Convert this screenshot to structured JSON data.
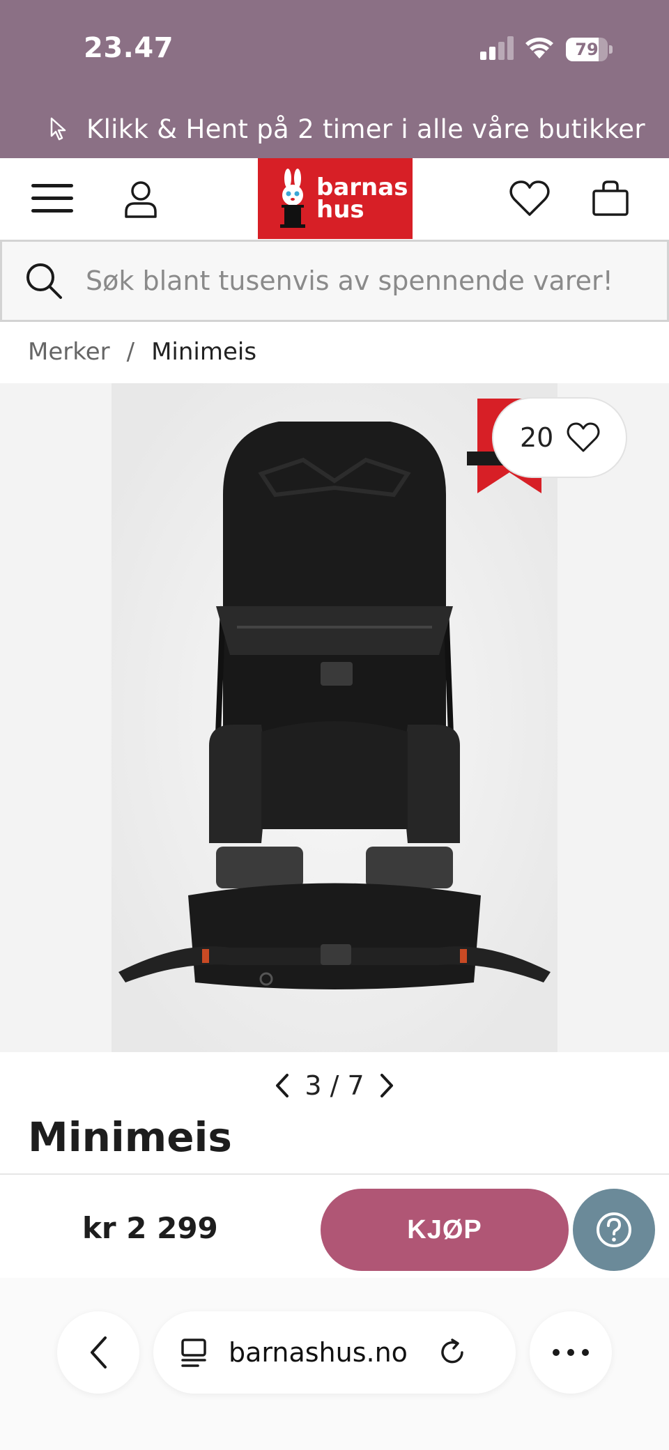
{
  "status_bar": {
    "time": "23.47",
    "battery": "79",
    "battery_level": 0.79
  },
  "promo": {
    "text": "Klikk & Hent på 2 timer i alle våre butikker"
  },
  "header": {
    "logo_line1": "barnas",
    "logo_line2": "hus"
  },
  "search": {
    "placeholder": "Søk blant tusenvis av spennende varer!"
  },
  "breadcrumb": {
    "items": [
      "Merker",
      "/",
      "Minimeis"
    ]
  },
  "gallery": {
    "wishlist_count": "20",
    "pager": "3 / 7"
  },
  "product": {
    "title": "Minimeis",
    "price": "kr 2 299",
    "buy_label": "KJØP"
  },
  "browser": {
    "url": "barnashus.no"
  },
  "colors": {
    "top_band": "#8b7085",
    "logo_red": "#d71f26",
    "buy_button": "#b05675",
    "help_button": "#6b8a99"
  }
}
